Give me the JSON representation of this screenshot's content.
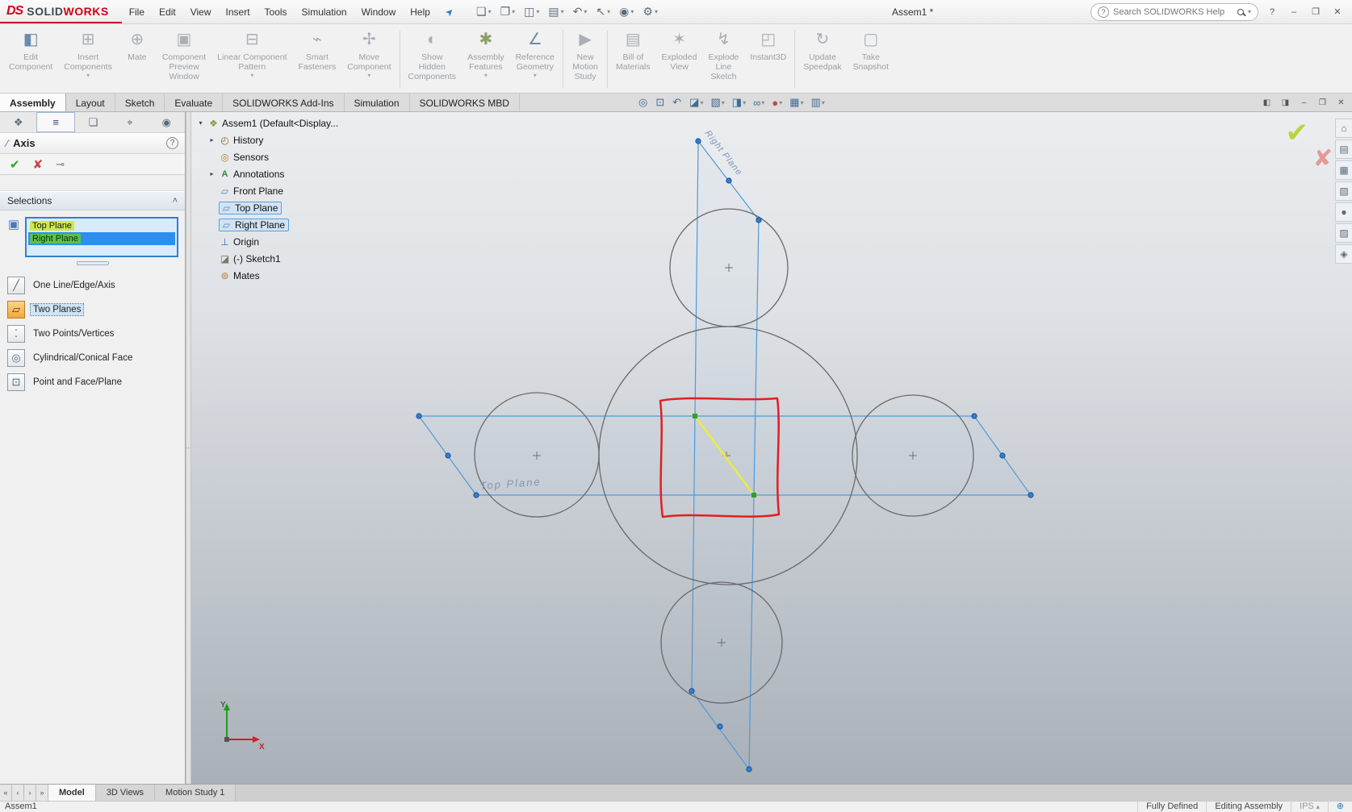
{
  "colors": {
    "brand_red": "#d0021b",
    "selection_green": "#cde84a",
    "selection_blue": "#2e8ef0",
    "plane_blue": "#4f9ad8",
    "sketch_red": "#e02020",
    "axis_yellow": "#ecec3e",
    "viewport_gradient_top": "#ebedef",
    "viewport_gradient_bottom": "#a9b0b8"
  },
  "menubar": {
    "brand": {
      "mark": "DS",
      "solid": "SOLID",
      "works": "WORKS"
    },
    "menus": [
      "File",
      "Edit",
      "View",
      "Insert",
      "Tools",
      "Simulation",
      "Window",
      "Help"
    ],
    "pin_glyph": "➤",
    "quick_tools": [
      {
        "name": "new",
        "glyph": "❏",
        "caret": "▾"
      },
      {
        "name": "open",
        "glyph": "❐",
        "caret": "▾"
      },
      {
        "name": "save",
        "glyph": "◫",
        "caret": "▾"
      },
      {
        "name": "print",
        "glyph": "▤",
        "caret": "▾"
      },
      {
        "name": "undo",
        "glyph": "↶",
        "caret": "▾"
      },
      {
        "name": "select",
        "glyph": "↖",
        "caret": "▾"
      },
      {
        "name": "rebuild",
        "glyph": "◉",
        "caret": "▾"
      },
      {
        "name": "options",
        "glyph": "⚙",
        "caret": "▾"
      }
    ],
    "title": "Assem1 *",
    "search": {
      "leading_glyph": "?",
      "placeholder": "Search SOLIDWORKS Help",
      "caret": "▾"
    },
    "window_controls": {
      "help": "?",
      "minimize": "–",
      "restore": "❐",
      "close": "✕"
    }
  },
  "ribbon": {
    "buttons": [
      {
        "label": "Edit\nComponent",
        "glyph": "◧"
      },
      {
        "label": "Insert\nComponents",
        "glyph": "⊞",
        "caret": "▾"
      },
      {
        "label": "Mate",
        "glyph": "⊕"
      },
      {
        "label": "Component\nPreview\nWindow",
        "glyph": "▣"
      },
      {
        "label": "Linear Component\nPattern",
        "glyph": "⊟",
        "caret": "▾"
      },
      {
        "label": "Smart\nFasteners",
        "glyph": "⌁"
      },
      {
        "label": "Move\nComponent",
        "glyph": "✢",
        "caret": "▾"
      },
      {
        "label": "Show\nHidden\nComponents",
        "glyph": "◐"
      },
      {
        "label": "Assembly\nFeatures",
        "glyph": "✱",
        "caret": "▾"
      },
      {
        "label": "Reference\nGeometry",
        "glyph": "∠",
        "caret": "▾"
      },
      {
        "label": "New\nMotion\nStudy",
        "glyph": "▶"
      },
      {
        "label": "Bill of\nMaterials",
        "glyph": "▤"
      },
      {
        "label": "Exploded\nView",
        "glyph": "✶"
      },
      {
        "label": "Explode\nLine\nSketch",
        "glyph": "↯"
      },
      {
        "label": "Instant3D",
        "glyph": "◰"
      },
      {
        "label": "Update\nSpeedpak",
        "glyph": "↻"
      },
      {
        "label": "Take\nSnapshot",
        "glyph": "▢"
      }
    ]
  },
  "command_tabs": {
    "items": [
      "Assembly",
      "Layout",
      "Sketch",
      "Evaluate",
      "SOLIDWORKS Add-Ins",
      "Simulation",
      "SOLIDWORKS MBD"
    ]
  },
  "headsup": {
    "items": [
      {
        "name": "zoom-fit",
        "glyph": "◎"
      },
      {
        "name": "zoom-area",
        "glyph": "⊡"
      },
      {
        "name": "previous-view",
        "glyph": "↶"
      },
      {
        "name": "section-view",
        "glyph": "◪",
        "caret": "▾"
      },
      {
        "name": "view-orientation",
        "glyph": "▧",
        "caret": "▾"
      },
      {
        "name": "display-style",
        "glyph": "◨",
        "caret": "▾"
      },
      {
        "name": "hide-show",
        "glyph": "∞",
        "caret": "▾"
      },
      {
        "name": "appearance",
        "glyph": "●",
        "caret": "▾"
      },
      {
        "name": "scene",
        "glyph": "▦",
        "caret": "▾"
      },
      {
        "name": "view-settings",
        "glyph": "▥",
        "caret": "▾"
      }
    ]
  },
  "mdi_controls": {
    "cascade": "◧",
    "tile": "◨",
    "minimize": "–",
    "restore": "❐",
    "close": "✕"
  },
  "property_manager": {
    "tabs": [
      {
        "glyph": "❖"
      },
      {
        "glyph": "≡"
      },
      {
        "glyph": "❏"
      },
      {
        "glyph": "⌖"
      },
      {
        "glyph": "◉"
      }
    ],
    "title": "Axis",
    "title_glyph": "∕",
    "help_glyph": "?",
    "ok_glyph": "✔",
    "cancel_glyph": "✘",
    "pin_glyph": "⊸",
    "selections": {
      "header": "Selections",
      "collapse_glyph": "˄",
      "box_icon_glyph": "▣",
      "items": [
        {
          "label": "Top Plane"
        },
        {
          "label": "Right Plane"
        }
      ]
    },
    "options": [
      {
        "label": "One Line/Edge/Axis",
        "glyph": "╱"
      },
      {
        "label": "Two Planes",
        "glyph": "▱"
      },
      {
        "label": "Two Points/Vertices",
        "glyph": "⁚"
      },
      {
        "label": "Cylindrical/Conical Face",
        "glyph": "◎"
      },
      {
        "label": "Point and Face/Plane",
        "glyph": "⊡"
      }
    ]
  },
  "feature_tree": {
    "items": [
      {
        "arrow": "▾",
        "glyph": "❖",
        "label": "Assem1 (Default<Display..."
      },
      {
        "arrow": "▸",
        "glyph": "◴",
        "label": "History"
      },
      {
        "glyph": "◎",
        "label": "Sensors"
      },
      {
        "arrow": "▸",
        "glyph": "A",
        "label": "Annotations"
      },
      {
        "glyph": "▱",
        "label": "Front Plane"
      },
      {
        "glyph": "▱",
        "label": "Top Plane"
      },
      {
        "glyph": "▱",
        "label": "Right Plane"
      },
      {
        "glyph": "⊥",
        "label": "Origin"
      },
      {
        "glyph": "◪",
        "label": "(-) Sketch1"
      },
      {
        "glyph": "⊚",
        "label": "Mates"
      }
    ]
  },
  "viewport": {
    "top_plane_label": "Top Plane",
    "right_plane_label": "Right Plane",
    "triad": {
      "x": "X",
      "y": "Y"
    },
    "confirm_glyph": "✔",
    "cancel_glyph": "✘"
  },
  "task_pane": {
    "items": [
      {
        "name": "resources",
        "glyph": "⌂"
      },
      {
        "name": "design-library",
        "glyph": "▤"
      },
      {
        "name": "file-explorer",
        "glyph": "▦"
      },
      {
        "name": "view-palette",
        "glyph": "▧"
      },
      {
        "name": "appearances",
        "glyph": "●"
      },
      {
        "name": "scenes",
        "glyph": "▨"
      },
      {
        "name": "custom-properties",
        "glyph": "◈"
      }
    ]
  },
  "motion_bar": {
    "nav": [
      "«",
      "‹",
      "›",
      "»"
    ],
    "tabs": [
      "Model",
      "3D Views",
      "Motion Study 1"
    ]
  },
  "status_bar": {
    "document": "Assem1",
    "state": "Fully Defined",
    "mode": "Editing Assembly",
    "units": "IPS",
    "units_caret": "▴",
    "network_glyph": "⊕"
  }
}
